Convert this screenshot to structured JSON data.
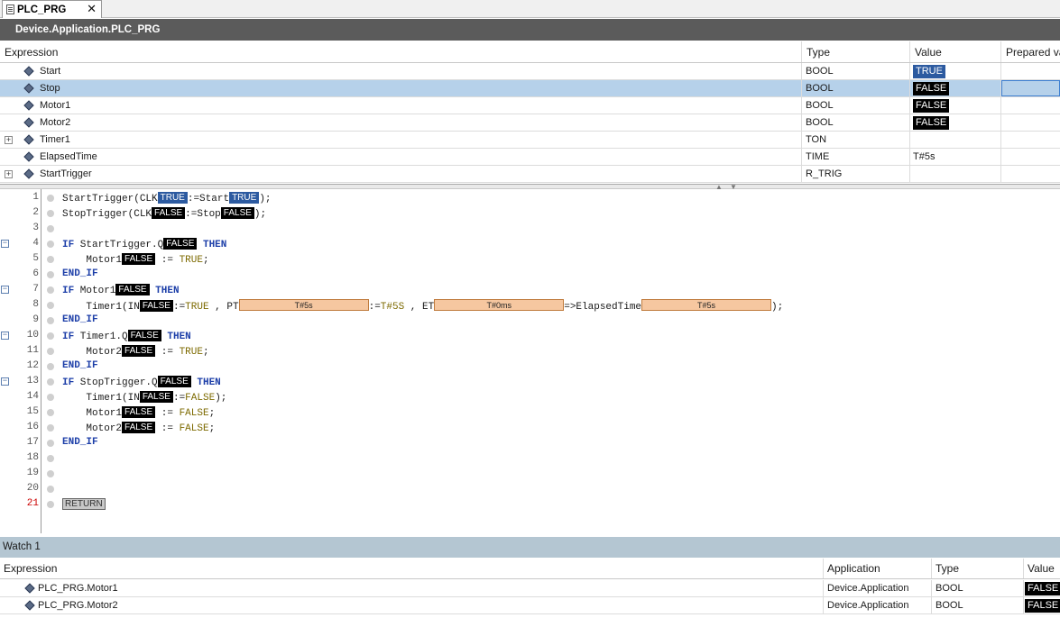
{
  "tab": {
    "title": "PLC_PRG",
    "close": "✕",
    "icon": "document-icon"
  },
  "path": "Device.Application.PLC_PRG",
  "var_table": {
    "headers": {
      "expression": "Expression",
      "type": "Type",
      "value": "Value",
      "prepared": "Prepared va"
    },
    "rows": [
      {
        "name": "Start",
        "type": "BOOL",
        "value": "TRUE",
        "value_kind": "true",
        "expandable": false,
        "selected": false
      },
      {
        "name": "Stop",
        "type": "BOOL",
        "value": "FALSE",
        "value_kind": "false",
        "expandable": false,
        "selected": true
      },
      {
        "name": "Motor1",
        "type": "BOOL",
        "value": "FALSE",
        "value_kind": "false",
        "expandable": false,
        "selected": false
      },
      {
        "name": "Motor2",
        "type": "BOOL",
        "value": "FALSE",
        "value_kind": "false",
        "expandable": false,
        "selected": false
      },
      {
        "name": "Timer1",
        "type": "TON",
        "value": "",
        "value_kind": "none",
        "expandable": true,
        "selected": false
      },
      {
        "name": "ElapsedTime",
        "type": "TIME",
        "value": "T#5s",
        "value_kind": "plain",
        "expandable": false,
        "selected": false
      },
      {
        "name": "StartTrigger",
        "type": "R_TRIG",
        "value": "",
        "value_kind": "none",
        "expandable": true,
        "selected": false
      }
    ]
  },
  "code": {
    "lines": [
      {
        "n": "1",
        "fold": false,
        "parts": [
          [
            "t",
            "StartTrigger(CLK"
          ],
          [
            "bt",
            "TRUE"
          ],
          [
            "t",
            ":=Start"
          ],
          [
            "bt",
            "TRUE"
          ],
          [
            "t",
            ");"
          ]
        ]
      },
      {
        "n": "2",
        "fold": false,
        "parts": [
          [
            "t",
            "StopTrigger(CLK"
          ],
          [
            "bf",
            "FALSE"
          ],
          [
            "t",
            ":=Stop"
          ],
          [
            "bf",
            "FALSE"
          ],
          [
            "t",
            ");"
          ]
        ]
      },
      {
        "n": "3",
        "fold": false,
        "parts": []
      },
      {
        "n": "4",
        "fold": true,
        "parts": [
          [
            "k",
            "IF"
          ],
          [
            "t",
            " StartTrigger.Q"
          ],
          [
            "bf",
            "FALSE"
          ],
          [
            "t",
            " "
          ],
          [
            "k",
            "THEN"
          ]
        ]
      },
      {
        "n": "5",
        "fold": false,
        "parts": [
          [
            "t",
            "    Motor1"
          ],
          [
            "bf",
            "FALSE"
          ],
          [
            "t",
            " := "
          ],
          [
            "s",
            "TRUE"
          ],
          [
            "t",
            ";"
          ]
        ]
      },
      {
        "n": "6",
        "fold": false,
        "parts": [
          [
            "k",
            "END_IF"
          ]
        ]
      },
      {
        "n": "7",
        "fold": true,
        "parts": [
          [
            "k",
            "IF"
          ],
          [
            "t",
            " Motor1"
          ],
          [
            "bf",
            "FALSE"
          ],
          [
            "t",
            " "
          ],
          [
            "k",
            "THEN"
          ]
        ]
      },
      {
        "n": "8",
        "fold": false,
        "parts": [
          [
            "t",
            "    Timer1(IN"
          ],
          [
            "bf",
            "FALSE"
          ],
          [
            "t",
            ":="
          ],
          [
            "s",
            "TRUE"
          ],
          [
            "t",
            " , PT"
          ],
          [
            "box",
            "T#5s"
          ],
          [
            "t",
            ":="
          ],
          [
            "s",
            "T#5S"
          ],
          [
            "t",
            " , ET"
          ],
          [
            "box",
            "T#0ms"
          ],
          [
            "t",
            "=>ElapsedTime"
          ],
          [
            "box",
            "T#5s"
          ],
          [
            "t",
            ");"
          ]
        ]
      },
      {
        "n": "9",
        "fold": false,
        "parts": [
          [
            "k",
            "END_IF"
          ]
        ]
      },
      {
        "n": "10",
        "fold": true,
        "parts": [
          [
            "k",
            "IF"
          ],
          [
            "t",
            " Timer1.Q"
          ],
          [
            "bf",
            "FALSE"
          ],
          [
            "t",
            " "
          ],
          [
            "k",
            "THEN"
          ]
        ]
      },
      {
        "n": "11",
        "fold": false,
        "parts": [
          [
            "t",
            "    Motor2"
          ],
          [
            "bf",
            "FALSE"
          ],
          [
            "t",
            " := "
          ],
          [
            "s",
            "TRUE"
          ],
          [
            "t",
            ";"
          ]
        ]
      },
      {
        "n": "12",
        "fold": false,
        "parts": [
          [
            "k",
            "END_IF"
          ]
        ]
      },
      {
        "n": "13",
        "fold": true,
        "parts": [
          [
            "k",
            "IF"
          ],
          [
            "t",
            " StopTrigger.Q"
          ],
          [
            "bf",
            "FALSE"
          ],
          [
            "t",
            " "
          ],
          [
            "k",
            "THEN"
          ]
        ]
      },
      {
        "n": "14",
        "fold": false,
        "parts": [
          [
            "t",
            "    Timer1(IN"
          ],
          [
            "bf",
            "FALSE"
          ],
          [
            "t",
            ":="
          ],
          [
            "s",
            "FALSE"
          ],
          [
            "t",
            ");"
          ]
        ]
      },
      {
        "n": "15",
        "fold": false,
        "parts": [
          [
            "t",
            "    Motor1"
          ],
          [
            "bf",
            "FALSE"
          ],
          [
            "t",
            " := "
          ],
          [
            "s",
            "FALSE"
          ],
          [
            "t",
            ";"
          ]
        ]
      },
      {
        "n": "16",
        "fold": false,
        "parts": [
          [
            "t",
            "    Motor2"
          ],
          [
            "bf",
            "FALSE"
          ],
          [
            "t",
            " := "
          ],
          [
            "s",
            "FALSE"
          ],
          [
            "t",
            ";"
          ]
        ]
      },
      {
        "n": "17",
        "fold": false,
        "parts": [
          [
            "k",
            "END_IF"
          ]
        ]
      },
      {
        "n": "18",
        "fold": false,
        "parts": []
      },
      {
        "n": "19",
        "fold": false,
        "parts": []
      },
      {
        "n": "20",
        "fold": false,
        "parts": []
      },
      {
        "n": "21",
        "fold": false,
        "last": true,
        "parts": [
          [
            "ret",
            "RETURN"
          ]
        ]
      }
    ]
  },
  "watch": {
    "title": "Watch 1",
    "headers": {
      "expression": "Expression",
      "application": "Application",
      "type": "Type",
      "value": "Value"
    },
    "rows": [
      {
        "expression": "PLC_PRG.Motor1",
        "application": "Device.Application",
        "type": "BOOL",
        "value": "FALSE"
      },
      {
        "expression": "PLC_PRG.Motor2",
        "application": "Device.Application",
        "type": "BOOL",
        "value": "FALSE"
      }
    ]
  },
  "colors": {
    "true_badge": "#2c5aa0",
    "false_badge": "#000000",
    "selected_row": "#b6d1ea",
    "keyword": "#1c3ea8",
    "literal": "#7d6a00",
    "timer_box": "#f6c7a0"
  }
}
